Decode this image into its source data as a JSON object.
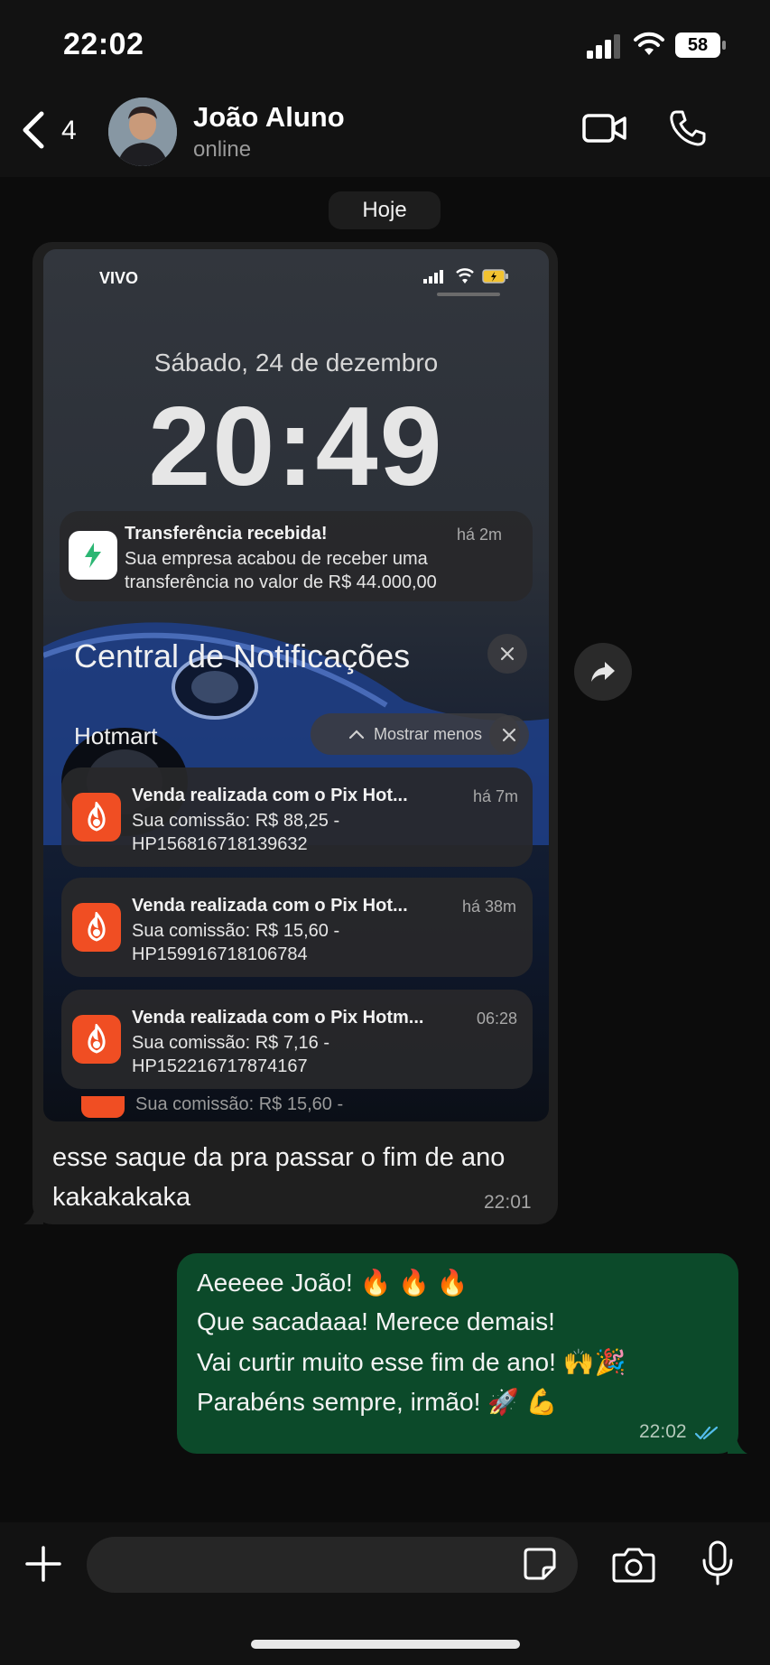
{
  "status_bar": {
    "time": "22:02",
    "battery": "58"
  },
  "header": {
    "back_count": "4",
    "contact_name": "João Aluno",
    "contact_status": "online"
  },
  "chat": {
    "date_label": "Hoje",
    "incoming": {
      "screenshot": {
        "carrier": "VIVO",
        "date": "Sábado, 24 de dezembro",
        "clock": "20:49",
        "transfer_notification": {
          "title": "Transferência recebida!",
          "time": "há 2m",
          "body_line1": "Sua empresa acabou de receber  uma",
          "body_line2": "transferência no valor de R$ 44.000,00"
        },
        "notification_center_title": "Central de Notificações",
        "group_label": "Hotmart",
        "show_less_label": "Mostrar menos",
        "notifications": [
          {
            "title": "Venda realizada com o Pix Hot...",
            "time": "há 7m",
            "line1": "Sua comissão: R$ 88,25 -",
            "line2": "HP156816718139632"
          },
          {
            "title": "Venda realizada com o Pix Hot...",
            "time": "há 38m",
            "line1": "Sua comissão: R$ 15,60 -",
            "line2": "HP159916718106784"
          },
          {
            "title": "Venda realizada com o Pix Hotm...",
            "time": "06:28",
            "line1": "Sua comissão: R$ 7,16 -",
            "line2": "HP152216717874167"
          }
        ],
        "peek_text": "Sua comissão: R$ 15,60 -"
      },
      "text_line1": "esse saque da pra passar o fim de ano",
      "text_line2": "kakakakaka",
      "time": "22:01"
    },
    "outgoing": {
      "lines": [
        "Aeeeee João! 🔥 🔥 🔥",
        "Que sacadaaa! Merece demais!",
        "Vai curtir muito esse fim de ano! 🙌🎉",
        "Parabéns sempre, irmão!  🚀 💪"
      ],
      "time": "22:02"
    }
  },
  "colors": {
    "outgoing_bubble": "#0c4a2a",
    "incoming_bubble": "#1f1f1f",
    "read_ticks": "#53bdeb",
    "hotmart_orange": "#f04e23",
    "transfer_green": "#2bb673"
  }
}
